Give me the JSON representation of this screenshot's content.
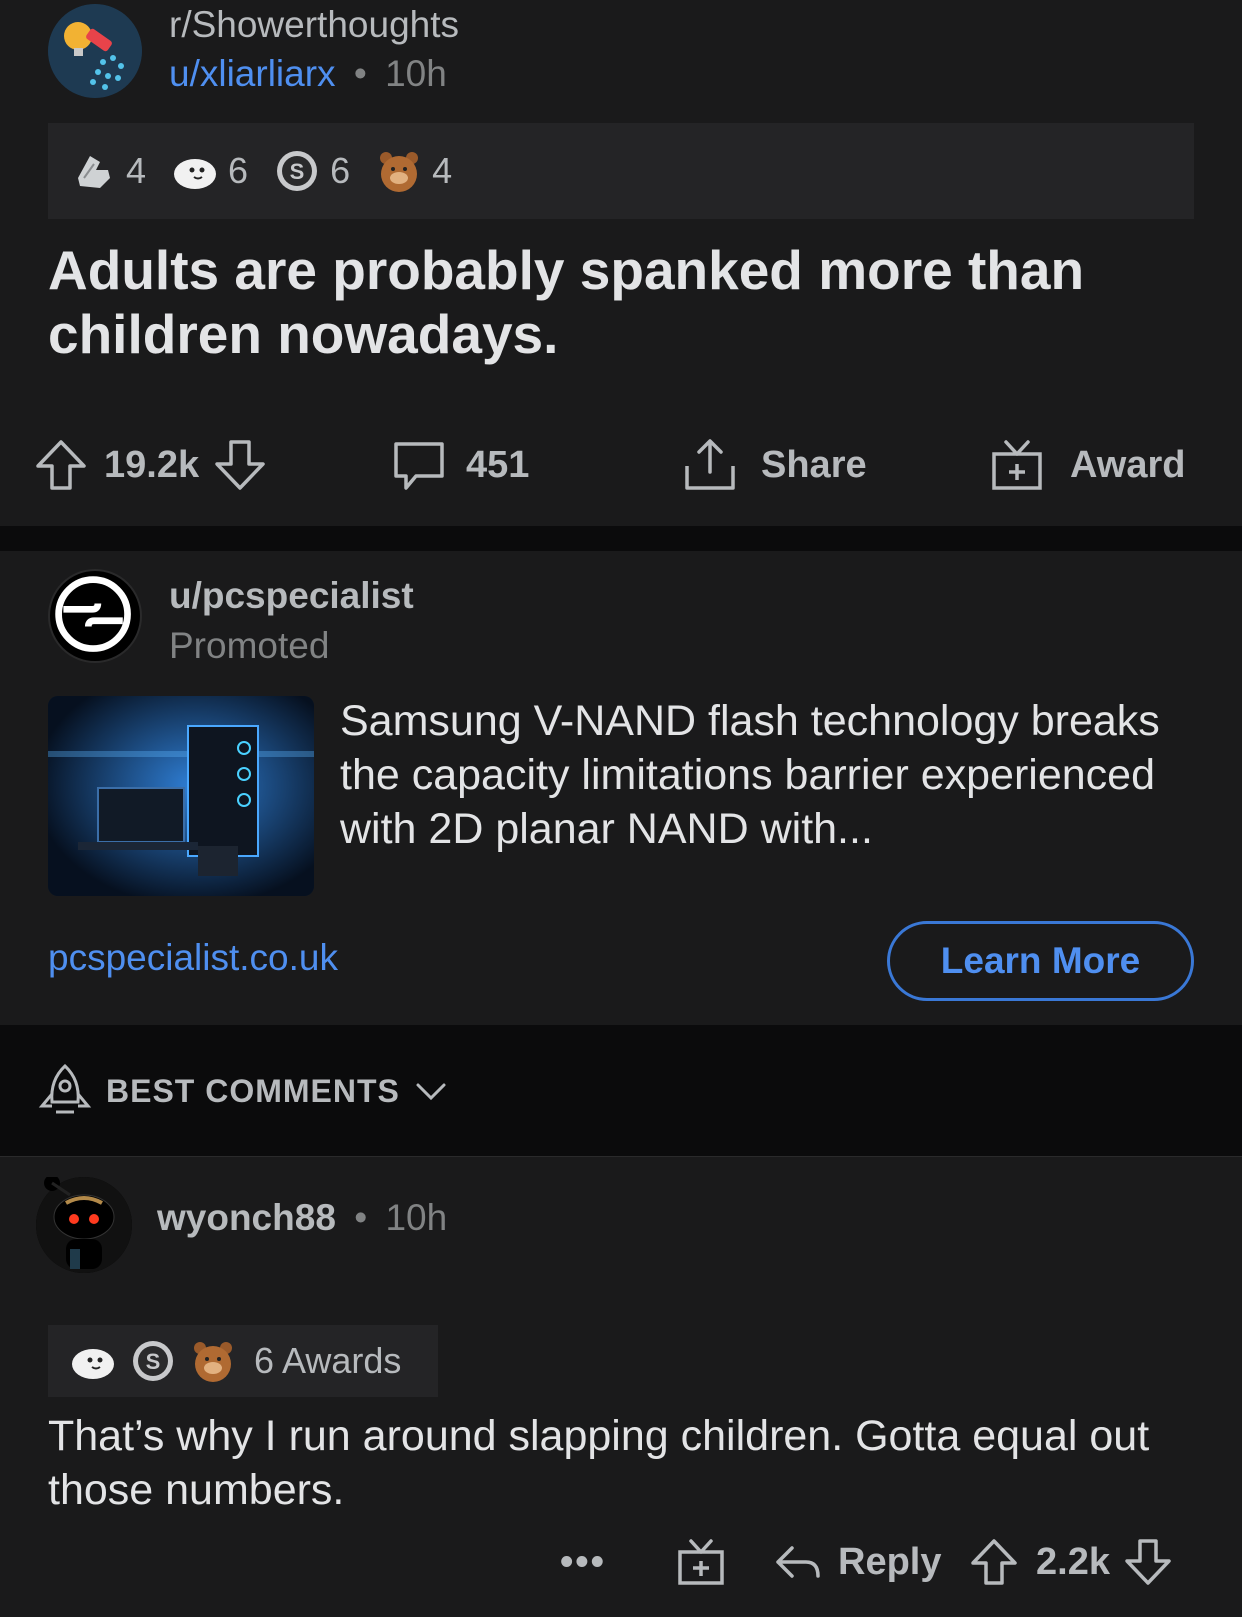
{
  "post": {
    "subreddit": "r/Showerthoughts",
    "author": "u/xliarliarx",
    "separator": "•",
    "age": "10h",
    "awards": [
      {
        "icon": "helpful-award-icon",
        "count": "4"
      },
      {
        "icon": "wholesome-seal-award-icon",
        "count": "6"
      },
      {
        "icon": "silver-award-icon",
        "count": "6"
      },
      {
        "icon": "bear-award-icon",
        "count": "4"
      }
    ],
    "title": "Adults are probably spanked more than children nowadays.",
    "votes": "19.2k",
    "comments": "451",
    "share_label": "Share",
    "award_label": "Award"
  },
  "ad": {
    "user": "u/pcspecialist",
    "promoted_label": "Promoted",
    "text": "Samsung V-NAND flash technology breaks the capacity limitations barrier experienced with 2D planar NAND with...",
    "domain": "pcspecialist.co.uk",
    "cta_label": "Learn More"
  },
  "sort": {
    "label": "BEST COMMENTS"
  },
  "comment": {
    "author": "wyonch88",
    "separator": "•",
    "age": "10h",
    "awards_label": "6 Awards",
    "award_icons": [
      "wholesome-seal-award-icon",
      "silver-award-icon",
      "bear-award-icon"
    ],
    "body": "That’s why I run around slapping children. Gotta equal out those numbers.",
    "more_label": "•••",
    "reply_label": "Reply",
    "votes": "2.2k"
  },
  "colors": {
    "background": "#1a1a1b",
    "link_blue": "#4f8ff0",
    "text_primary": "#e3e4e6",
    "text_muted": "#818384"
  }
}
